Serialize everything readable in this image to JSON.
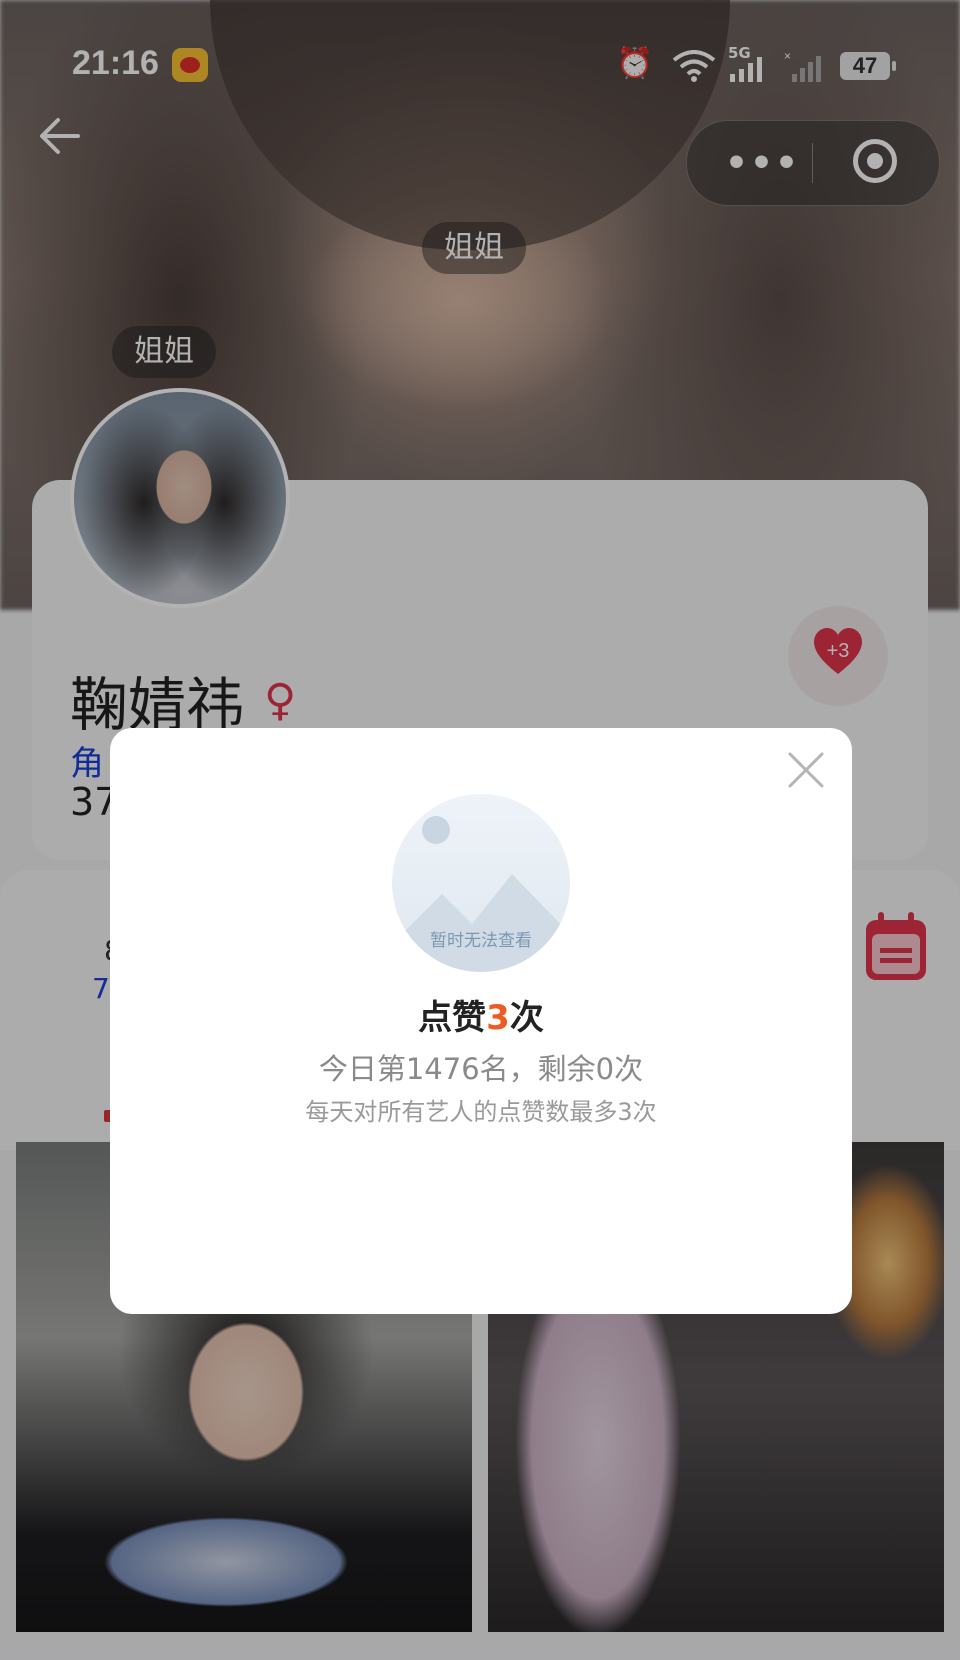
{
  "status_bar": {
    "time": "21:16",
    "network": "5G",
    "battery": "47"
  },
  "profile": {
    "nickname_tag": "姐姐",
    "nickname_tag_top": "姐姐",
    "name": "鞠婧祎",
    "gender_symbol": "♀",
    "role_partial": "角",
    "stat_partial": "37",
    "like_badge": "+3"
  },
  "section": {
    "line1_partial": "8",
    "line2_partial": "7"
  },
  "modal": {
    "placeholder_text": "暂时无法查看",
    "title_prefix": "点赞",
    "title_count": "3",
    "title_suffix": "次",
    "rank_text": "今日第1476名，剩余0次",
    "limit_note": "每天对所有艺人的点赞数最多3次"
  },
  "colors": {
    "accent_orange": "#ee5a24",
    "heart_red": "#e0344d",
    "link_blue": "#1a3fd8"
  }
}
